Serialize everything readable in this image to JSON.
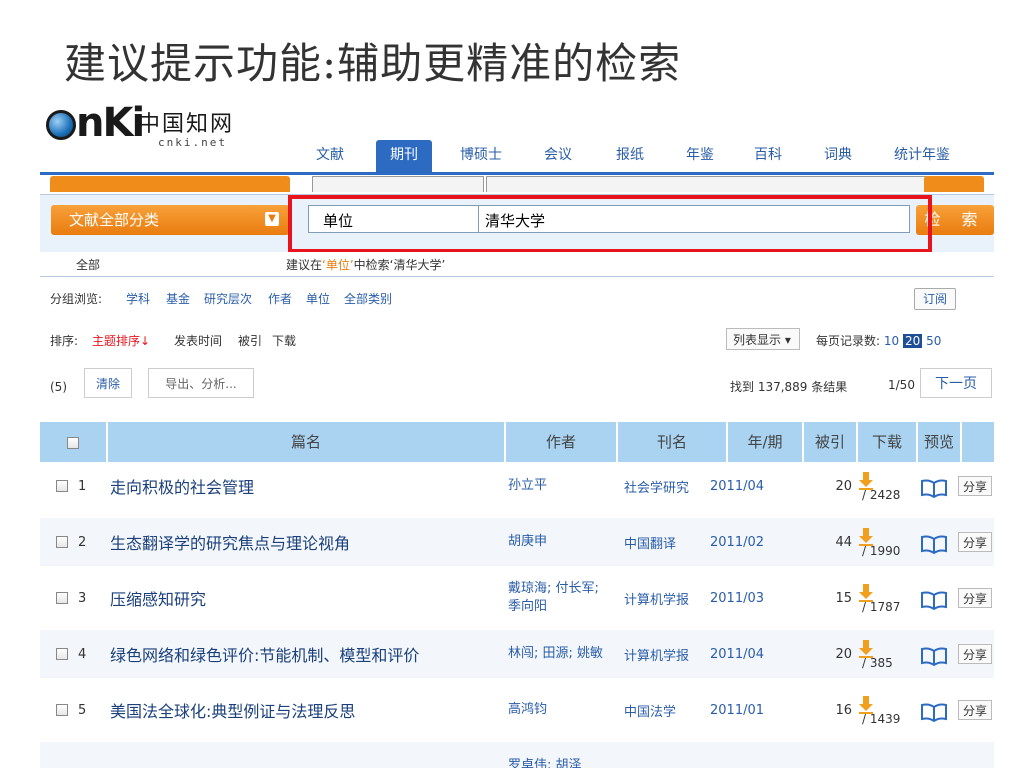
{
  "slide_title": "建议提示功能:辅助更精准的检索",
  "logo": {
    "cn": "中国知网",
    "sub": "cnki.net",
    "mark": "nKi"
  },
  "nav": {
    "tabs": [
      "文献",
      "期刊",
      "博硕士",
      "会议",
      "报纸",
      "年鉴",
      "百科",
      "词典",
      "统计年鉴"
    ],
    "active_index": 1
  },
  "search": {
    "category_label": "文献全部分类",
    "field_label": "单位",
    "query": "清华大学",
    "button_label": "检 索"
  },
  "suggest": {
    "all_label": "全部",
    "tip_prefix": "建议在",
    "tip_field": "‘单位’",
    "tip_middle": "中检索",
    "tip_query": "‘清华大学’"
  },
  "browse": {
    "label": "分组浏览:",
    "items": [
      "学科",
      "基金",
      "研究层次",
      "作者",
      "单位",
      "全部类别"
    ],
    "subscribe": "订阅"
  },
  "sort": {
    "label": "排序:",
    "items": [
      "主题排序↓",
      "发表时间",
      "被引",
      "下载"
    ],
    "active_index": 0
  },
  "display": {
    "mode": "列表显示 ▾",
    "perpage_label": "每页记录数:",
    "perpage_options": [
      "10",
      "20",
      "50"
    ],
    "perpage_selected": "20"
  },
  "actions": {
    "count": "(5)",
    "clear": "清除",
    "export": "导出、分析...",
    "found": "找到 137,889 条结果",
    "page": "1/50",
    "next": "下一页"
  },
  "table": {
    "headers": [
      "篇名",
      "作者",
      "刊名",
      "年/期",
      "被引",
      "下载",
      "预览"
    ],
    "rows": [
      {
        "no": "1",
        "title": "走向积极的社会管理",
        "author": "孙立平",
        "journal": "社会学研究",
        "date": "2011/04",
        "cited": "20",
        "downloads": "/ 2428",
        "share": "分享"
      },
      {
        "no": "2",
        "title": "生态翻译学的研究焦点与理论视角",
        "author": "胡庚申",
        "journal": "中国翻译",
        "date": "2011/02",
        "cited": "44",
        "downloads": "/ 1990",
        "share": "分享"
      },
      {
        "no": "3",
        "title": "压缩感知研究",
        "author": "戴琼海; 付长军; 季向阳",
        "journal": "计算机学报",
        "date": "2011/03",
        "cited": "15",
        "downloads": "/ 1787",
        "share": "分享"
      },
      {
        "no": "4",
        "title": "绿色网络和绿色评价:节能机制、模型和评价",
        "author": "林闯; 田源; 姚敏",
        "journal": "计算机学报",
        "date": "2011/04",
        "cited": "20",
        "downloads": "/ 385",
        "share": "分享"
      },
      {
        "no": "5",
        "title": "美国法全球化:典型例证与法理反思",
        "author": "高鸿钧",
        "journal": "中国法学",
        "date": "2011/01",
        "cited": "16",
        "downloads": "/ 1439",
        "share": "分享"
      },
      {
        "no": "",
        "title": "",
        "author": "罗卓伟; 胡泽",
        "journal": "",
        "date": "",
        "cited": "",
        "downloads": "",
        "share": ""
      }
    ]
  },
  "colors": {
    "accent_blue": "#2d6bc2",
    "orange": "#e97c0f",
    "highlight_red": "#e8141b",
    "header_blue": "#a9d3f1"
  }
}
